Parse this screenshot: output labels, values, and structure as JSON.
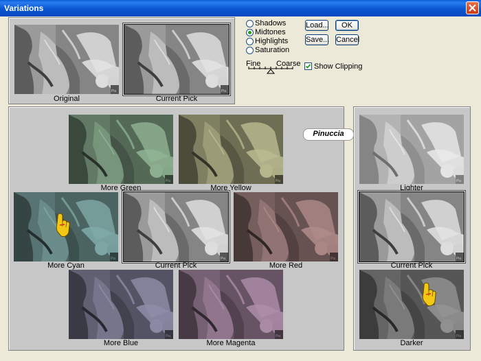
{
  "window": {
    "title": "Variations"
  },
  "colors": {
    "title_bar": "#0a56d0",
    "panel": "#c7c7c7",
    "dialog": "#ece9d8",
    "radio_selected": "#21a121",
    "hand_pointer": "#f2c814"
  },
  "preview": {
    "original_label": "Original",
    "current_pick_label": "Current Pick"
  },
  "tones": [
    {
      "label": "Shadows",
      "selected": false
    },
    {
      "label": "Midtones",
      "selected": true
    },
    {
      "label": "Highlights",
      "selected": false
    },
    {
      "label": "Saturation",
      "selected": false
    }
  ],
  "buttons": {
    "load": "Load...",
    "ok": "OK",
    "save": "Save...",
    "cancel": "Cancel"
  },
  "slider": {
    "fine_label": "Fine",
    "coarse_label": "Coarse",
    "level": 0.5
  },
  "show_clipping": {
    "label": "Show Clipping",
    "checked": true
  },
  "watermark": "Pinuccia",
  "color_variations": {
    "more_green": "More Green",
    "more_yellow": "More Yellow",
    "more_cyan": "More Cyan",
    "current_pick": "Current Pick",
    "more_red": "More Red",
    "more_blue": "More Blue",
    "more_magenta": "More Magenta"
  },
  "brightness_variations": {
    "lighter": "Lighter",
    "current_pick": "Current Pick",
    "darker": "Darker"
  },
  "icons": [
    "close-icon",
    "checkmark-icon",
    "hand-pointer-icon"
  ]
}
